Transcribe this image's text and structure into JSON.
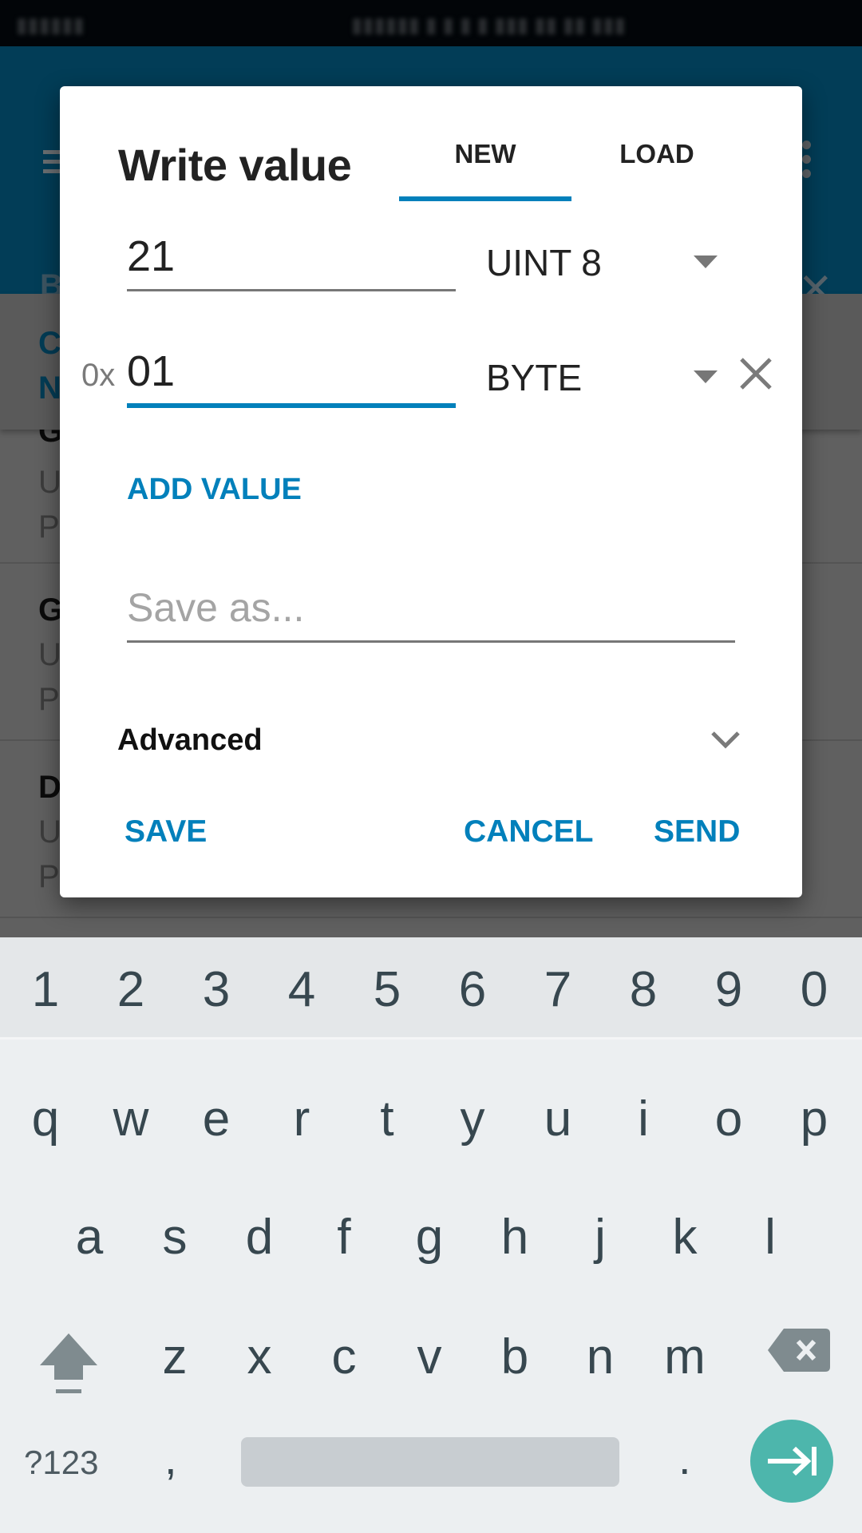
{
  "background": {
    "appbar": {
      "title_partial": "B",
      "menu_icon": "hamburger-icon",
      "overflow_icon": "more-vert-icon",
      "close_icon": "close-icon"
    },
    "list_header": {
      "line1": "C",
      "line2": "N"
    },
    "list_items": [
      {
        "title": "G",
        "line1": "U",
        "line2": "P"
      },
      {
        "title": "G",
        "line1": "U",
        "line2": "P"
      },
      {
        "title": "D",
        "line1": "U",
        "line2": "P"
      }
    ]
  },
  "dialog": {
    "title": "Write value",
    "tabs": [
      {
        "label": "NEW",
        "active": true
      },
      {
        "label": "LOAD",
        "active": false
      }
    ],
    "values": [
      {
        "prefix": "",
        "value": "21",
        "type": "UINT 8",
        "focused": false,
        "removable": false
      },
      {
        "prefix": "0x",
        "value": "01",
        "type": "BYTE",
        "focused": true,
        "removable": true
      }
    ],
    "add_value_label": "ADD VALUE",
    "save_as_placeholder": "Save as...",
    "save_as_value": "",
    "advanced_label": "Advanced",
    "actions": {
      "save": "SAVE",
      "cancel": "CANCEL",
      "send": "SEND"
    },
    "accent_color": "#0280bb"
  },
  "keyboard": {
    "number_row": [
      "1",
      "2",
      "3",
      "4",
      "5",
      "6",
      "7",
      "8",
      "9",
      "0"
    ],
    "row1": [
      "q",
      "w",
      "e",
      "r",
      "t",
      "y",
      "u",
      "i",
      "o",
      "p"
    ],
    "row2": [
      "a",
      "s",
      "d",
      "f",
      "g",
      "h",
      "j",
      "k",
      "l"
    ],
    "row3": [
      "z",
      "x",
      "c",
      "v",
      "b",
      "n",
      "m"
    ],
    "symbols_label": "?123",
    "comma": ",",
    "period": ".",
    "enter_icon": "tab-next-icon",
    "enter_color": "#4db6ac"
  }
}
